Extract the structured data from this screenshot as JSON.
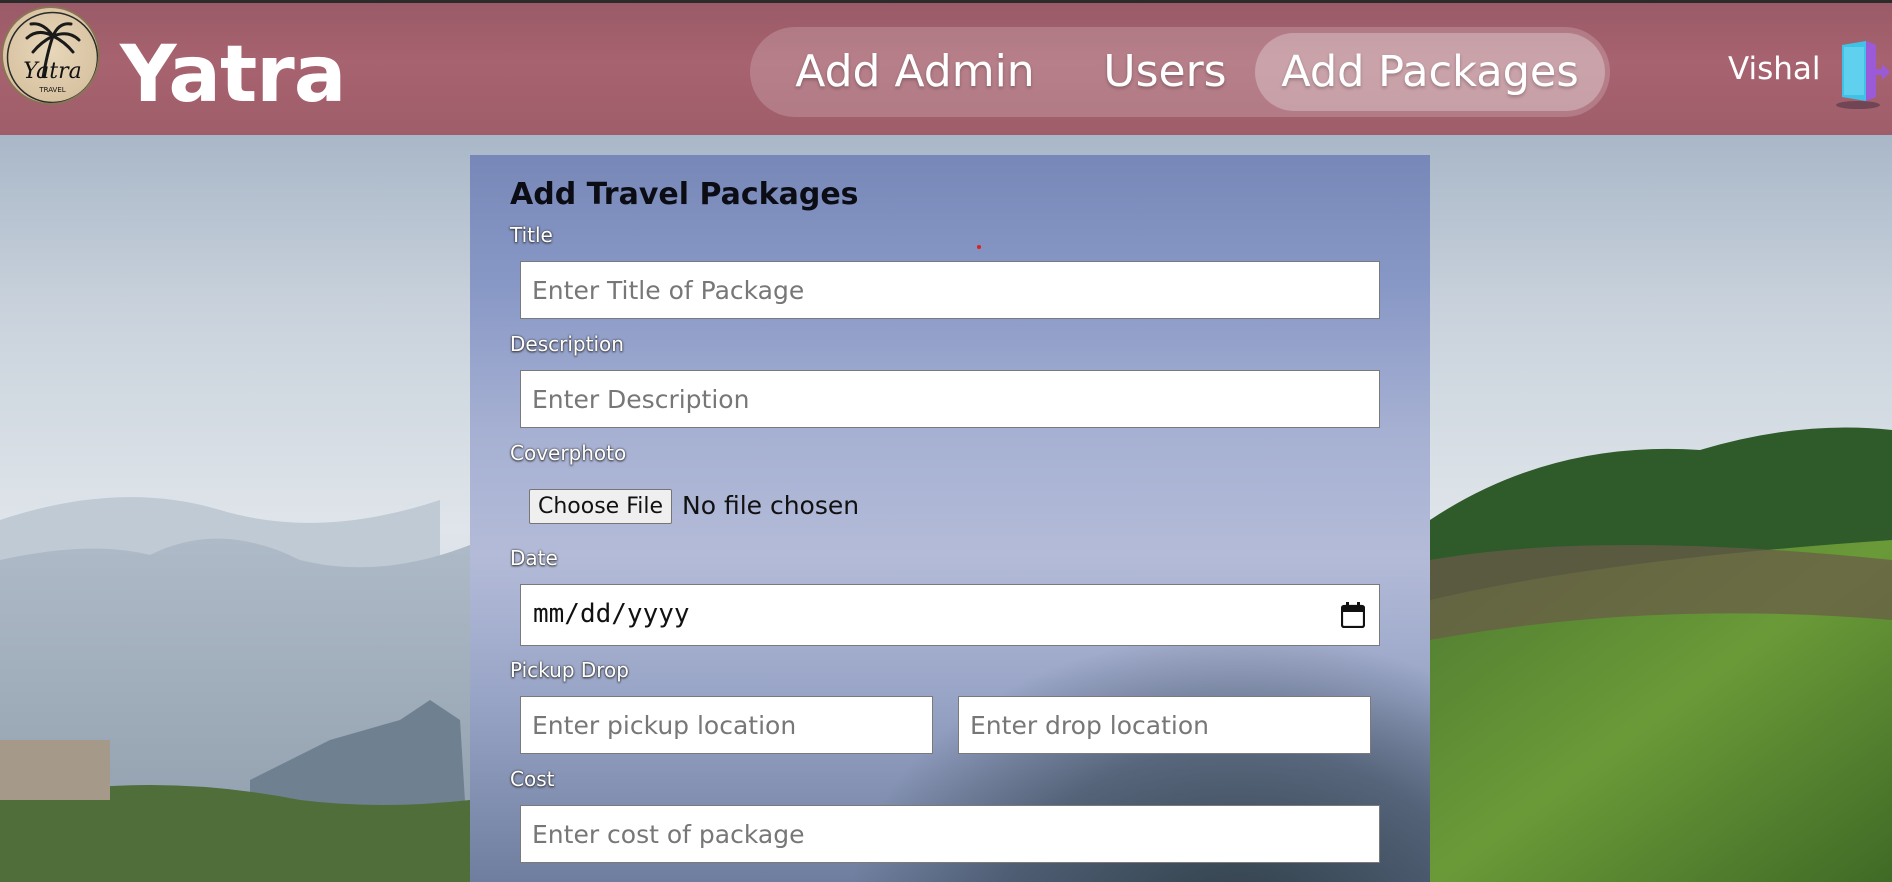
{
  "app": {
    "brand": "Yatra",
    "logo_text": "Yatra",
    "logo_subtext": "TRAVEL"
  },
  "nav": {
    "items": [
      {
        "label": "Add Admin"
      },
      {
        "label": "Users"
      },
      {
        "label": "Add Packages",
        "active": true
      }
    ]
  },
  "user": {
    "name": "Vishal",
    "logout_icon": "logout-door-icon"
  },
  "form": {
    "title": "Add Travel Packages",
    "title_label": "Title",
    "title_placeholder": "Enter Title of Package",
    "description_label": "Description",
    "description_placeholder": "Enter Description",
    "coverphoto_label": "Coverphoto",
    "file_button": "Choose File",
    "file_status": "No file chosen",
    "date_label": "Date",
    "date_placeholder": "mm/dd/yyyy",
    "pickup_drop_label": "Pickup Drop",
    "pickup_placeholder": "Enter pickup location",
    "drop_placeholder": "Enter drop location",
    "cost_label": "Cost",
    "cost_placeholder": "Enter cost of package"
  },
  "colors": {
    "header": "#a7636f",
    "panel": "#8898c6",
    "active_tab": "#c99aa2"
  }
}
